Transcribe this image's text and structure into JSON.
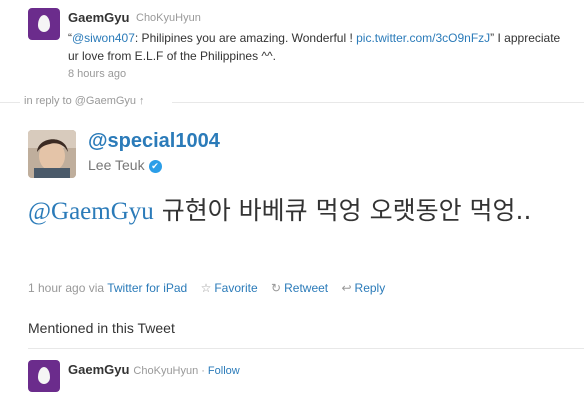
{
  "top_tweet": {
    "name": "GaemGyu",
    "screen_name": "ChoKyuHyun",
    "text_open_quote": "“",
    "mention": "@siwon407",
    "text_mid": ": Philipines you are amazing. Wonderful ! ",
    "link": "pic.twitter.com/3cO9nFzJ",
    "text_close": "” I appreciate ur love from E.L.F of the Philippines ^^.",
    "time": "8 hours ago"
  },
  "reply_bar": {
    "label": "in reply to @GaemGyu",
    "arrow": "↑"
  },
  "main_tweet": {
    "screen_name": "@special1004",
    "name": "Lee Teuk",
    "verified_icon": "✔",
    "mention": "@GaemGyu",
    "text": " 규현아 바베큐 먹엉 오랫동안 먹엉..",
    "time": "1 hour ago",
    "via_label": "via",
    "source": "Twitter for iPad",
    "actions": {
      "favorite_icon": "☆",
      "favorite": "Favorite",
      "retweet_icon": "↻",
      "retweet": "Retweet",
      "reply_icon": "↩",
      "reply": "Reply"
    }
  },
  "mentioned": {
    "heading": "Mentioned in this Tweet",
    "user": {
      "name": "GaemGyu",
      "screen_name": "ChoKyuHyun",
      "separator": "·",
      "follow": "Follow"
    }
  },
  "colors": {
    "link": "#2b7bb9",
    "egg_bg": "#6b2c8c",
    "verified": "#2b9ee8"
  }
}
